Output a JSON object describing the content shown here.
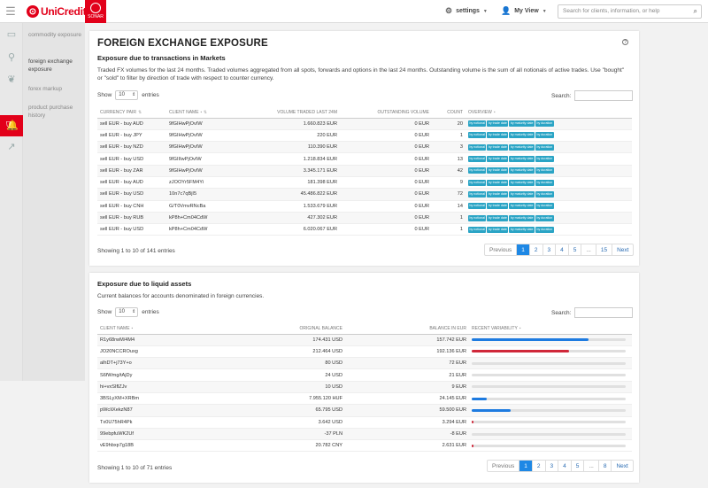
{
  "header": {
    "logo_text": "UniCredit",
    "sonar_label": "SONAR",
    "settings_label": "settings",
    "myview_label": "My View",
    "search_placeholder": "Search for clients, information, or help"
  },
  "sidebar": {
    "items": [
      {
        "label": "commodity exposure"
      },
      {
        "label": "foreign exchange exposure"
      },
      {
        "label": "forex markup"
      },
      {
        "label": "product purchase history"
      }
    ]
  },
  "page": {
    "title": "FOREIGN EXCHANGE EXPOSURE",
    "help_icon": "?"
  },
  "section1": {
    "title": "Exposure due to transactions in Markets",
    "description": "Traded FX volumes for the last 24 months. Traded volumes aggregated from all spots, forwards and options in the last 24 months. Outstanding volume is the sum of all notionals of active trades. Use \"bought\" or \"sold\" to filter by direction of trade with respect to counter currency.",
    "show_label": "Show",
    "show_value": "10",
    "entries_label": "entries",
    "search_label": "Search:",
    "columns": [
      "CURRENCY PAIR",
      "CLIENT NAME",
      "VOLUME TRADED LAST 24M",
      "OUTSTANDING VOLUME",
      "COUNT",
      "OVERVIEW"
    ],
    "badges": [
      "by notional",
      "by trade date",
      "by maturity date",
      "by duration"
    ],
    "rows": [
      {
        "pair": "sell EUR - buy AUD",
        "client": "9fGIHwPjOvIW",
        "volume": "1.660.823 EUR",
        "outstanding": "0 EUR",
        "count": "20"
      },
      {
        "pair": "sell EUR - buy JPY",
        "client": "9fGIHwPjOvIW",
        "volume": "220 EUR",
        "outstanding": "0 EUR",
        "count": "1"
      },
      {
        "pair": "sell EUR - buy NZD",
        "client": "9fGIHwPjOvIW",
        "volume": "110.390 EUR",
        "outstanding": "0 EUR",
        "count": "3"
      },
      {
        "pair": "sell EUR - buy USD",
        "client": "9fGIIIwPjOvIW",
        "volume": "1.218.834 EUR",
        "outstanding": "0 EUR",
        "count": "13"
      },
      {
        "pair": "sell EUR - buy ZAR",
        "client": "9fGIHwPjOvIW",
        "volume": "3.345.171 EUR",
        "outstanding": "0 EUR",
        "count": "42"
      },
      {
        "pair": "sell EUR - buy AUD",
        "client": "zJOOYr5FM4Yi",
        "volume": "181.398 EUR",
        "outstanding": "0 EUR",
        "count": "9"
      },
      {
        "pair": "sell EUR - buy USD",
        "client": "10n7c7qBjI5",
        "volume": "45.486.822 EUR",
        "outstanding": "0 EUR",
        "count": "72"
      },
      {
        "pair": "sell EUR - buy CNH",
        "client": "G/T0VmvRNcBa",
        "volume": "1.533.679 EUR",
        "outstanding": "0 EUR",
        "count": "14"
      },
      {
        "pair": "sell EUR - buy RUB",
        "client": "kP8h+Cm04CdW",
        "volume": "427.302 EUR",
        "outstanding": "0 EUR",
        "count": "1"
      },
      {
        "pair": "sell EUR - buy USD",
        "client": "kP8h+Cm04CdW",
        "volume": "6.020.067 EUR",
        "outstanding": "0 EUR",
        "count": "1"
      }
    ],
    "showing": "Showing 1 to 10 of 141 entries",
    "pager": [
      "Previous",
      "1",
      "2",
      "3",
      "4",
      "5",
      "...",
      "15",
      "Next"
    ]
  },
  "section2": {
    "title": "Exposure due to liquid assets",
    "description": "Current balances for accounts denominated in foreign currencies.",
    "show_label": "Show",
    "show_value": "10",
    "entries_label": "entries",
    "search_label": "Search:",
    "columns": [
      "CLIENT NAME",
      "ORIGINAL BALANCE",
      "BALANCE IN EUR",
      "RECENT VARIABILITY"
    ],
    "rows": [
      {
        "client": "R1y68rwM/4M4",
        "original": "174.431 USD",
        "eur": "157.742 EUR",
        "var": 0.76,
        "color": "#1e7be0"
      },
      {
        "client": "JO20NCCROuxg",
        "original": "212.464 USD",
        "eur": "192.136 EUR",
        "var": 0.63,
        "color": "#d0283a"
      },
      {
        "client": "alhDT+j73Y+o",
        "original": "80 USD",
        "eur": "72 EUR",
        "var": 0,
        "color": "#1e7be0"
      },
      {
        "client": "S6fWmg/tAjDy",
        "original": "24 USD",
        "eur": "21 EUR",
        "var": 0,
        "color": "#1e7be0"
      },
      {
        "client": "hi+vxSIflZJv",
        "original": "10 USD",
        "eur": "9 EUR",
        "var": 0,
        "color": "#1e7be0"
      },
      {
        "client": "3BSLyXM+XRBm",
        "original": "7.955.120 HUF",
        "eur": "24.145 EUR",
        "var": 0.1,
        "color": "#1e7be0"
      },
      {
        "client": "pWcIiXekzN87",
        "original": "65.795 USD",
        "eur": "59.500 EUR",
        "var": 0.25,
        "color": "#1e7be0"
      },
      {
        "client": "Tx0U75hR4Pk",
        "original": "3.642 USD",
        "eur": "3.294 EUR",
        "var": 0.01,
        "color": "#d0283a"
      },
      {
        "client": "99ebpfuWK2Uf",
        "original": "-37 PLN",
        "eur": "-8 EUR",
        "var": 0,
        "color": "#1e7be0"
      },
      {
        "client": "vE9hbxp7g18B",
        "original": "20.782 CNY",
        "eur": "2.631 EUR",
        "var": 0.01,
        "color": "#d0283a"
      }
    ],
    "showing": "Showing 1 to 10 of 71 entries",
    "pager": [
      "Previous",
      "1",
      "2",
      "3",
      "4",
      "5",
      "...",
      "8",
      "Next"
    ]
  }
}
